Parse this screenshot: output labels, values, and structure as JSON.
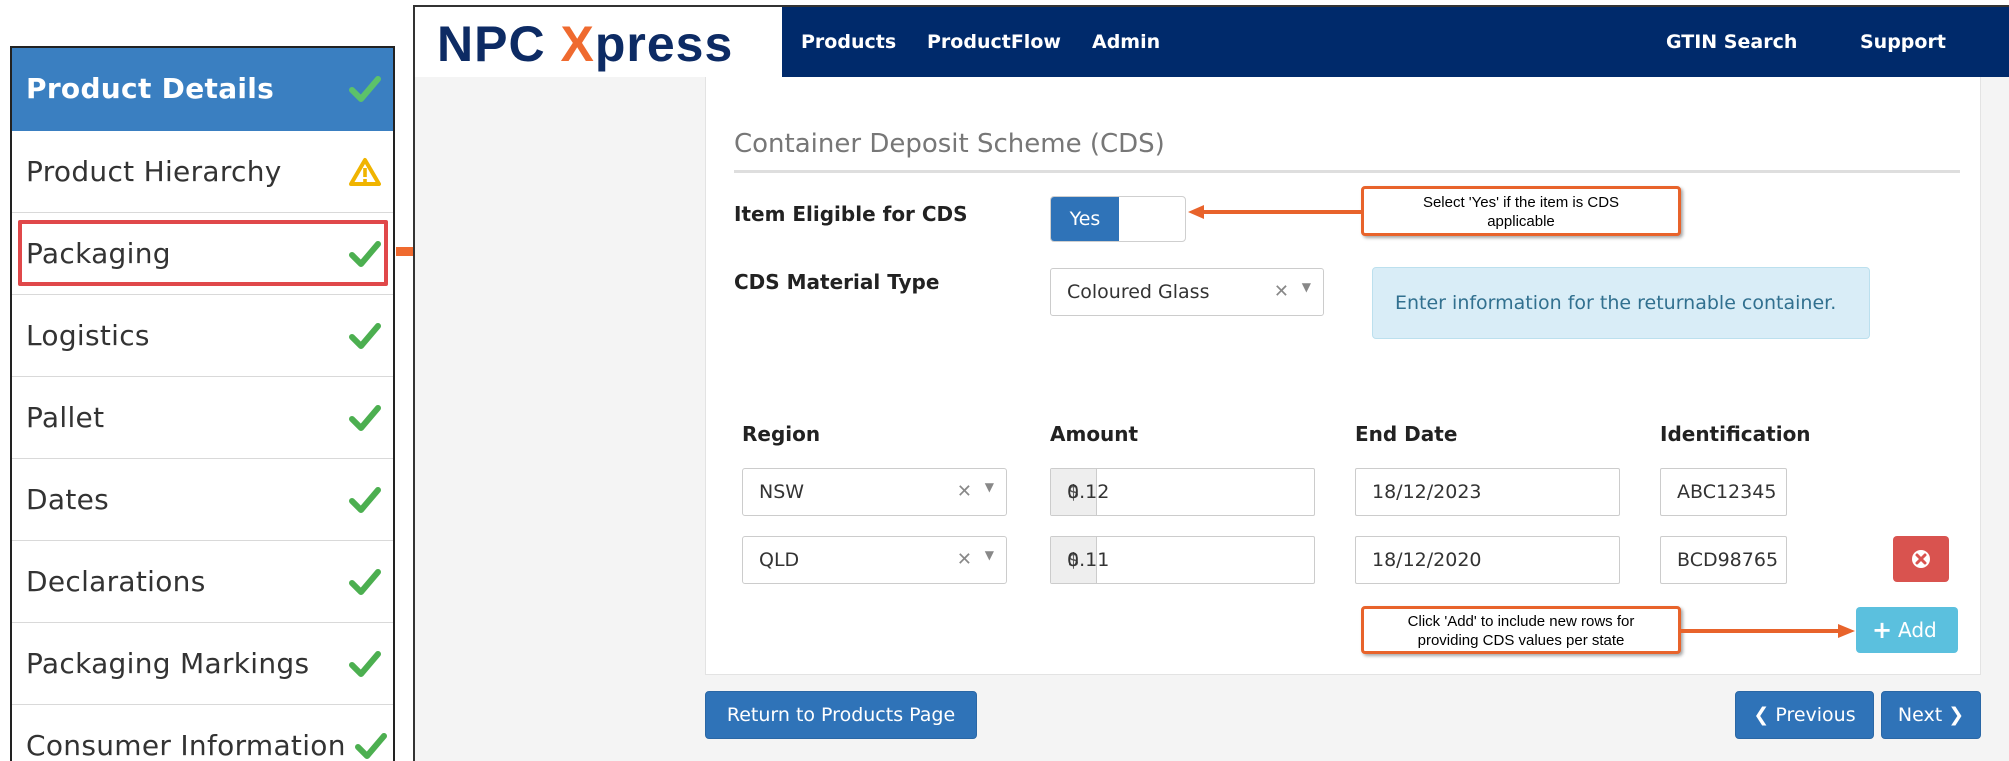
{
  "sidebar": {
    "items": [
      {
        "label": "Product Details",
        "status": "complete",
        "status_icon": "check-icon"
      },
      {
        "label": "Product Hierarchy",
        "status": "warning",
        "status_icon": "warning-icon"
      },
      {
        "label": "Packaging",
        "status": "complete",
        "status_icon": "check-icon"
      },
      {
        "label": "Logistics",
        "status": "complete",
        "status_icon": "check-icon"
      },
      {
        "label": "Pallet",
        "status": "complete",
        "status_icon": "check-icon"
      },
      {
        "label": "Dates",
        "status": "complete",
        "status_icon": "check-icon"
      },
      {
        "label": "Declarations",
        "status": "complete",
        "status_icon": "check-icon"
      },
      {
        "label": "Packaging Markings",
        "status": "complete",
        "status_icon": "check-icon"
      },
      {
        "label": "Consumer Information",
        "status": "complete",
        "status_icon": "check-icon"
      }
    ],
    "active_index": 0,
    "highlighted_index": 2
  },
  "header": {
    "brand_prefix": "NPC ",
    "brand_x": "X",
    "brand_suffix": "press",
    "nav": [
      "Products",
      "ProductFlow",
      "Admin"
    ],
    "nav_right": [
      "GTIN Search",
      "Support"
    ]
  },
  "form": {
    "section_title": "Container Deposit Scheme (CDS)",
    "eligible_label": "Item Eligible for CDS",
    "eligible_value": "Yes",
    "material_label": "CDS Material Type",
    "material_value": "Coloured Glass",
    "info_text": "Enter information for the returnable container.",
    "columns": [
      "Region",
      "Amount",
      "End Date",
      "Identification"
    ],
    "currency_symbol": "$",
    "rows": [
      {
        "region": "NSW",
        "amount": "0.12",
        "end_date": "18/12/2023",
        "identification": "ABC12345"
      },
      {
        "region": "QLD",
        "amount": "0.11",
        "end_date": "18/12/2020",
        "identification": "BCD98765"
      }
    ],
    "add_label": "Add"
  },
  "callouts": {
    "eligible_line1": "Select 'Yes' if the item is CDS",
    "eligible_line2": "applicable",
    "add_line1": "Click 'Add' to include new rows for",
    "add_line2": "providing CDS values per state"
  },
  "footer": {
    "return_label": "Return to Products Page",
    "previous_label": "Previous",
    "next_label": "Next"
  },
  "colors": {
    "nav_bar": "#002a6b",
    "brand_blue": "#0d2b64",
    "brand_orange": "#ef6a2f",
    "active_item": "#3a7fc1",
    "primary_button": "#2f73b8",
    "danger_button": "#d9534f",
    "info_button": "#5bc0de",
    "callout_border": "#e8632b",
    "check_green": "#4caf50",
    "warning_yellow": "#f0b400"
  }
}
